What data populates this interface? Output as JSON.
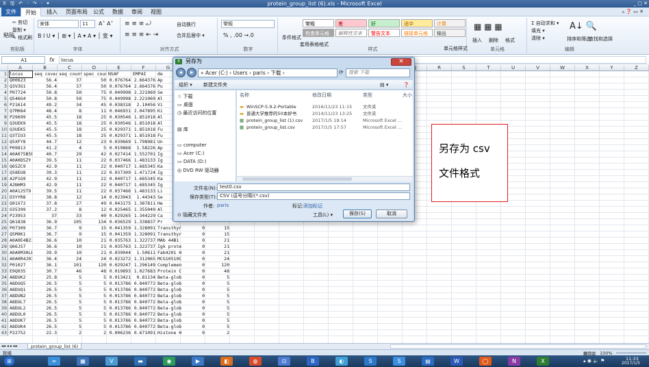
{
  "window": {
    "title": "protein_group_list (6).xls - Microsoft Excel",
    "quick_access": "X 🖫 ↶ · ↷ · ▾",
    "controls": "_ ▢ ✕",
    "ribbon_right": "▵ ❓ ▭ ✕"
  },
  "tabs": [
    "文件",
    "开始",
    "插入",
    "页面布局",
    "公式",
    "数据",
    "审阅",
    "视图"
  ],
  "ribbon": {
    "clipboard": {
      "label": "剪贴板",
      "paste": "粘贴",
      "cut": "✂ 剪切",
      "copy": "复制 ▾",
      "format_painter": "✎ 格式刷"
    },
    "font": {
      "label": "字体",
      "family": "宋体",
      "size": "11",
      "grow": "A˄ A˅",
      "format_row": "B I U ▾ │ ⊞ ▾ │ A ▾ A ▾ │ 变 ▾"
    },
    "align": {
      "label": "对齐方式",
      "wrap": "自动换行",
      "merge": "合并后居中 ▾"
    },
    "number": {
      "label": "数字",
      "format": "常规",
      "symbols": "% , .00 →.0"
    },
    "styles": {
      "label": "样式",
      "conditional": "条件格式",
      "table": "套用表格格式",
      "cell_styles": "单元格样式",
      "gallery": [
        {
          "name": "常规",
          "bg": "#ffffff",
          "fg": "#000000"
        },
        {
          "name": "差",
          "bg": "#ffc7ce",
          "fg": "#9c0006"
        },
        {
          "name": "好",
          "bg": "#c6efce",
          "fg": "#006100"
        },
        {
          "name": "适中",
          "bg": "#ffeb9c",
          "fg": "#9c5700"
        },
        {
          "name": "计算",
          "bg": "#f2f2f2",
          "fg": "#fa7d00"
        },
        {
          "name": "检查单元格",
          "bg": "#a5a5a5",
          "fg": "#ffffff"
        },
        {
          "name": "解释性文本",
          "bg": "#ffffff",
          "fg": "#7f7f7f"
        },
        {
          "name": "警告文本",
          "bg": "#ffffff",
          "fg": "#ff0000"
        },
        {
          "name": "链接单元格",
          "bg": "#ffffff",
          "fg": "#fa7d00"
        },
        {
          "name": "输出",
          "bg": "#f2f2f2",
          "fg": "#3f3f3f"
        }
      ]
    },
    "cells": {
      "label": "单元格",
      "insert": "插入",
      "delete": "删除",
      "format": "格式"
    },
    "editing": {
      "label": "编辑",
      "autosum": "Σ 自动求和 ▾",
      "fill": "填充 ▾",
      "clear": "清除 ▾",
      "sort": "排序和筛选",
      "find": "查找和选择"
    }
  },
  "formula_bar": {
    "cell_ref": "A1",
    "fx": "fx",
    "value": "locus"
  },
  "columns": [
    {
      "label": "A",
      "w": 36
    },
    {
      "label": "B",
      "w": 36
    },
    {
      "label": "C",
      "w": 36
    },
    {
      "label": "D",
      "w": 36
    },
    {
      "label": "E",
      "w": 36
    },
    {
      "label": "F",
      "w": 36
    },
    {
      "label": "G",
      "w": 36
    },
    {
      "label": "H",
      "w": 36
    },
    {
      "label": "I",
      "w": 36
    },
    {
      "label": "J",
      "w": 36
    },
    {
      "label": "K",
      "w": 36
    },
    {
      "label": "L",
      "w": 36
    },
    {
      "label": "M",
      "w": 36
    },
    {
      "label": "N",
      "w": 36
    },
    {
      "label": "O",
      "w": 36
    },
    {
      "label": "P",
      "w": 36
    },
    {
      "label": "Q",
      "w": 36
    },
    {
      "label": "R",
      "w": 36
    },
    {
      "label": "S",
      "w": 36
    },
    {
      "label": "T",
      "w": 36
    },
    {
      "label": "U",
      "w": 36
    },
    {
      "label": "V",
      "w": 36
    },
    {
      "label": "W",
      "w": 36
    },
    {
      "label": "X",
      "w": 36
    },
    {
      "label": "Y",
      "w": 36
    },
    {
      "label": "Z",
      "w": 36
    }
  ],
  "rows": [
    [
      "locus",
      "seq cover",
      "seq count",
      "spec count",
      "NSAF",
      "EMPAI",
      "de",
      "",
      ""
    ],
    [
      "Q00623",
      "56.4",
      "37",
      "50",
      "0.076764",
      "2.664376",
      "Ap",
      "",
      ""
    ],
    [
      "Q3V3G1",
      "56.4",
      "37",
      "50",
      "0.076764",
      "2.664376",
      "Pu",
      "",
      ""
    ],
    [
      "P07724",
      "50.8",
      "50",
      "75",
      "0.049998",
      "2.221069",
      "Se",
      "",
      ""
    ],
    [
      "Q546G4",
      "50.8",
      "50",
      "75",
      "0.049998",
      "2.221069",
      "Al",
      "",
      ""
    ],
    [
      "P21614",
      "49.2",
      "34",
      "45",
      "0.038318",
      "2.10456",
      "Vi",
      "",
      ""
    ],
    [
      "Q7M084",
      "48.4",
      "8",
      "11",
      "0.046931",
      "2.047895",
      "Ki",
      "",
      ""
    ],
    [
      "P29699",
      "45.5",
      "18",
      "25",
      "0.030546",
      "1.851018",
      "Al",
      "",
      ""
    ],
    [
      "Q3UEK9",
      "45.5",
      "18",
      "25",
      "0.030546",
      "1.851018",
      "Al",
      "",
      ""
    ],
    [
      "Q3UEK5",
      "45.5",
      "18",
      "25",
      "0.029371",
      "1.851018",
      "Fu",
      "",
      ""
    ],
    [
      "Q3TIU3",
      "45.5",
      "18",
      "25",
      "0.029371",
      "1.851018",
      "Fu",
      "",
      ""
    ],
    [
      "Q5XFY8",
      "44.7",
      "12",
      "23",
      "0.039669",
      "1.798981",
      "Un",
      "",
      ""
    ],
    [
      "P09813",
      "41.2",
      "4",
      "5",
      "0.019868",
      "1.58226",
      "Ap",
      "",
      ""
    ],
    [
      "A0A075B5F",
      "40.7",
      "29",
      "42",
      "0.027414",
      "1.552701",
      "Ig",
      "",
      ""
    ],
    [
      "A0A0D5ZY",
      "39.5",
      "11",
      "22",
      "0.037466",
      "1.483133",
      "Ig",
      "",
      ""
    ],
    [
      "Q65ZC9",
      "42.9",
      "11",
      "22",
      "0.040717",
      "1.685345",
      "Ka",
      "",
      ""
    ],
    [
      "Q58EU8",
      "39.3",
      "11",
      "22",
      "0.037309",
      "1.471724",
      "Ig",
      "",
      ""
    ],
    [
      "A2P1G9",
      "42.9",
      "11",
      "22",
      "0.040717",
      "1.685345",
      "Ka",
      "",
      ""
    ],
    [
      "A2NHM3",
      "42.9",
      "11",
      "22",
      "0.040717",
      "1.685345",
      "Ig",
      "",
      ""
    ],
    [
      "A0A125T9",
      "39.5",
      "11",
      "22",
      "0.037466",
      "1.483133",
      "Li",
      "",
      ""
    ],
    [
      "D3YYR8",
      "38.8",
      "12",
      "14",
      "0.023943",
      "1.44343",
      "Se",
      "",
      ""
    ],
    [
      "Q91X72",
      "37.8",
      "27",
      "49",
      "0.043175",
      "1.387811",
      "He",
      "",
      ""
    ],
    [
      "O35399",
      "37.2",
      "8",
      "12",
      "0.025465",
      "1.355049",
      "Al",
      "",
      ""
    ],
    [
      "P23953",
      "37",
      "33",
      "40",
      "0.029265",
      "1.344229",
      "Ca",
      "",
      ""
    ],
    [
      "Q61838",
      "36.9",
      "105",
      "134",
      "0.036529",
      "1.338837",
      "Pr",
      "",
      ""
    ],
    [
      "P07309",
      "36.7",
      "9",
      "15",
      "0.041359",
      "1.328091",
      "Transthyr",
      "0",
      "15"
    ],
    [
      "Q5M9K1",
      "36.7",
      "9",
      "15",
      "0.041359",
      "1.328091",
      "Transthyr",
      "0",
      "15"
    ],
    [
      "A0A0E4B21",
      "36.6",
      "10",
      "21",
      "0.035763",
      "1.322737",
      "MAb 44B1",
      "0",
      "21"
    ],
    [
      "Q66JS7",
      "36.6",
      "10",
      "21",
      "0.035763",
      "1.322737",
      "Igk prote",
      "0",
      "21"
    ],
    [
      "A0A0M3HLE",
      "39.9",
      "10",
      "21",
      "0.039044",
      "1.50611",
      "Fab4201 H",
      "0",
      "21"
    ],
    [
      "A0A0R4J0I",
      "36.4",
      "24",
      "24",
      "0.023272",
      "1.312065",
      "MCG10510C",
      "0",
      "24"
    ],
    [
      "P01027",
      "36.1",
      "101",
      "120",
      "0.029247",
      "1.296149",
      "Complemen",
      "0",
      "120"
    ],
    [
      "E9Q035",
      "30.7",
      "46",
      "48",
      "0.019893",
      "1.027683",
      "Protein C",
      "0",
      "48"
    ],
    [
      "A8DUK2",
      "25.8",
      "5",
      "5",
      "0.013421",
      "0.81134",
      "Beta-glob",
      "0",
      "5"
    ],
    [
      "A8DUQ5",
      "26.5",
      "5",
      "5",
      "0.013786",
      "0.840772",
      "Beta-glob",
      "0",
      "5"
    ],
    [
      "A8DUQ1",
      "26.5",
      "5",
      "5",
      "0.013786",
      "0.840772",
      "Beta-glob",
      "0",
      "5"
    ],
    [
      "A8DUN2",
      "26.5",
      "5",
      "5",
      "0.013786",
      "0.840772",
      "Beta-glob",
      "0",
      "5"
    ],
    [
      "A8DUL7",
      "26.5",
      "5",
      "5",
      "0.013786",
      "0.840772",
      "Beta-glob",
      "0",
      "5"
    ],
    [
      "A8DUL2",
      "26.5",
      "5",
      "5",
      "0.013786",
      "0.840772",
      "Beta-glob",
      "0",
      "5"
    ],
    [
      "A8DUL0",
      "26.5",
      "5",
      "5",
      "0.013786",
      "0.840772",
      "Beta-glob",
      "0",
      "5"
    ],
    [
      "A8DUK7",
      "26.5",
      "5",
      "5",
      "0.013786",
      "0.840772",
      "Beta-glob",
      "0",
      "5"
    ],
    [
      "A8DUK4",
      "26.5",
      "5",
      "5",
      "0.013786",
      "0.840772",
      "Beta-glob",
      "0",
      "5"
    ],
    [
      "P22752",
      "22.3",
      "2",
      "2",
      "0.006236",
      "0.671091",
      "Histone H",
      "0",
      "2"
    ]
  ],
  "sheet_tab": "protein_group_list (6)",
  "sheet_nav": "◂◂ ◂ ▸ ▸▸",
  "status": {
    "ready": "就绪",
    "zoom": "100%"
  },
  "taskbar": {
    "icons": [
      "⊞",
      "∞",
      "▦",
      "V",
      "▬",
      "◉",
      "▶",
      "◧",
      "◍",
      "⊡",
      "B",
      "◐",
      "S",
      "S",
      "▤",
      "W",
      "◯",
      "N",
      "X"
    ],
    "tray": "▴ ◉ 🔈 ⚑",
    "time": "11:33",
    "date": "2017/1/5"
  },
  "dialog": {
    "title": "另存为",
    "close": "✕",
    "nav_back": "◂",
    "nav_fwd": "▸",
    "address": "« Acer (C:) › Users › paris › 下载 ›",
    "search_placeholder": "搜索 下载",
    "toolbar": {
      "organize": "组织 ▾",
      "new_folder": "新建文件夹",
      "view": "▤ ▾",
      "help": "❓"
    },
    "nav_items": [
      "☆ 下载",
      "▭ 桌面",
      "◷ 最近访问的位置",
      "",
      "▤ 库",
      "",
      "▭ computer",
      "▭ Acer (C:)",
      "▭ DATA (D:)",
      "◎ DVD RW 驱动器"
    ],
    "file_headers": {
      "name": "名称",
      "date": "修改日期",
      "type": "类型",
      "size": "大小"
    },
    "files": [
      {
        "name": "WinSCP-5.9.2-Portable",
        "date": "2016/11/23 11:15",
        "type": "文件夹"
      },
      {
        "name": "普通大学推荐的50本好书",
        "date": "2014/11/23 13:25",
        "type": "文件夹"
      },
      {
        "name": "protein_group_list (1).csv",
        "date": "2017/1/5 19:14",
        "type": "Microsoft Excel ..."
      },
      {
        "name": "protein_group_list.csv",
        "date": "2017/1/5 17:57",
        "type": "Microsoft Excel ..."
      }
    ],
    "filename_label": "文件名(N):",
    "filename": "test0.csv",
    "filetype_label": "保存类型(T):",
    "filetype": "CSV (逗号分隔)(*.csv)",
    "author_label": "作者:",
    "author": "paris",
    "tags_label": "标记:",
    "tags": "添加标记",
    "hide_folders": "隐藏文件夹",
    "tools": "工具(L)  ▾",
    "save": "保存(S)",
    "cancel": "取消"
  },
  "annotation": {
    "line1": "另存为 csv",
    "line2": "文件格式"
  }
}
